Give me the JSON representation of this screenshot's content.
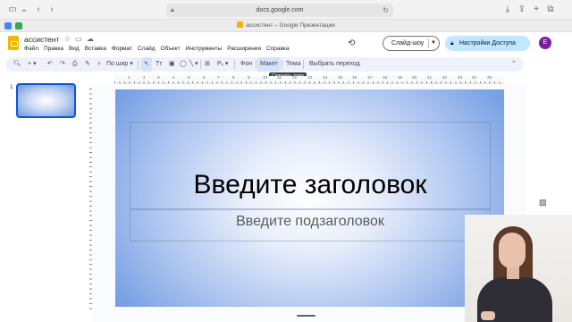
{
  "browser": {
    "url": "docs.google.com",
    "tab_title": "ассистент – Google Презентации",
    "icons": [
      "sidebar-icon",
      "chevron-down-icon",
      "back-icon",
      "forward-icon",
      "lock-icon",
      "reload-icon",
      "download-icon",
      "share-icon",
      "new-tab-icon",
      "tabs-overview-icon"
    ]
  },
  "app": {
    "doc_title": "ассистент",
    "menu": [
      "Файл",
      "Правка",
      "Вид",
      "Вставка",
      "Формат",
      "Слайд",
      "Объект",
      "Инструменты",
      "Расширения",
      "Справка"
    ],
    "slideshow_label": "Слайд-шоу",
    "share_label": "Настройки Доступа",
    "avatar_letter": "E",
    "accent_color": "#c2e7ff",
    "avatar_color": "#7b1fa2"
  },
  "toolbar": {
    "zoom_label": "По шир",
    "background_label": "Фон",
    "layout_label": "Макет",
    "theme_label": "Тема",
    "transition_label": "Выбрать переход",
    "tooltip": "Сменить тему"
  },
  "ruler": {
    "top_numbers": [
      "1",
      "2",
      "3",
      "4",
      "5",
      "6",
      "7",
      "8",
      "9",
      "10",
      "11",
      "12",
      "13",
      "14",
      "15",
      "16",
      "17",
      "18",
      "19",
      "20",
      "21",
      "22",
      "23",
      "24",
      "25"
    ]
  },
  "filmstrip": {
    "slide_number": "1"
  },
  "slide": {
    "title": "Введите заголовок",
    "subtitle": "Введите подзаголовок",
    "gradient_center": "#ffffff",
    "gradient_edge": "#6d96e0"
  }
}
